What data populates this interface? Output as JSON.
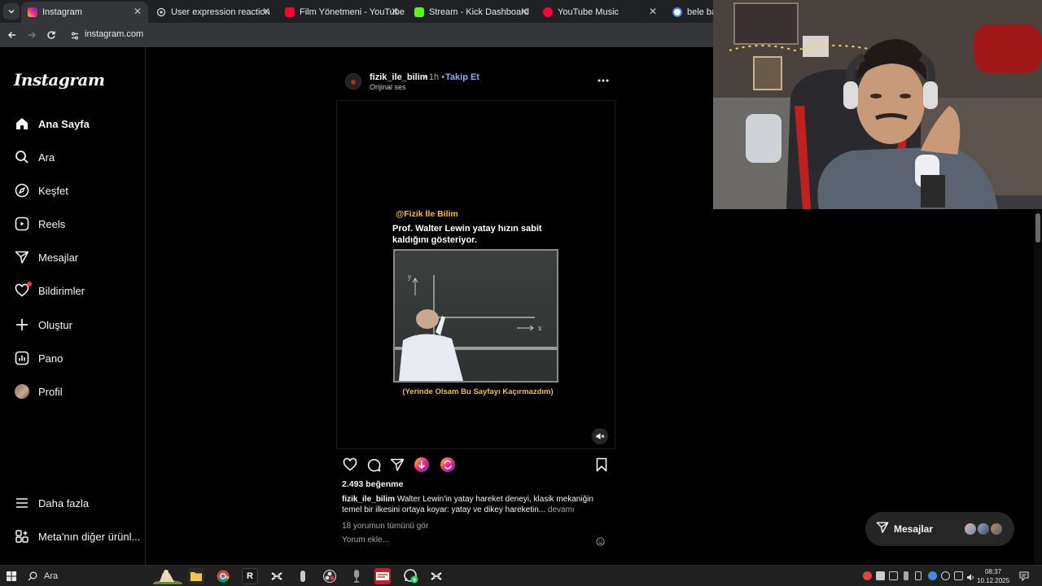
{
  "browser": {
    "tabs": [
      {
        "label": "Instagram",
        "icon": "instagram-icon",
        "color": "#e1306c",
        "active": true
      },
      {
        "label": "User expression reaction",
        "icon": "openai-icon",
        "color": "#d9d9d9",
        "active": false
      },
      {
        "label": "Film Yönetmeni - YouTube",
        "icon": "youtube-icon",
        "color": "#ff0033",
        "active": false
      },
      {
        "label": "Stream - Kick Dashboard",
        "icon": "kick-icon",
        "color": "#53fc18",
        "active": false
      },
      {
        "label": "YouTube Music",
        "icon": "youtube-music-icon",
        "color": "#ff0033",
        "active": false
      },
      {
        "label": "bele bağl",
        "icon": "google-icon",
        "color": "#4285f4",
        "active": false
      }
    ],
    "url": "instagram.com"
  },
  "sidebar": {
    "logo": "Instagram",
    "items": [
      {
        "label": "Ana Sayfa",
        "icon": "home-icon"
      },
      {
        "label": "Ara",
        "icon": "search-icon"
      },
      {
        "label": "Keşfet",
        "icon": "compass-icon"
      },
      {
        "label": "Reels",
        "icon": "reels-icon"
      },
      {
        "label": "Mesajlar",
        "icon": "messenger-icon"
      },
      {
        "label": "Bildirimler",
        "icon": "heart-icon"
      },
      {
        "label": "Oluştur",
        "icon": "plus-icon"
      },
      {
        "label": "Pano",
        "icon": "dashboard-icon"
      },
      {
        "label": "Profil",
        "icon": "avatar"
      }
    ],
    "more": "Daha fazla",
    "meta": "Meta'nın diğer ürünl..."
  },
  "post": {
    "username": "fizik_ile_bilim",
    "time": "• 1h •",
    "follow": "Takip Et",
    "audio": "Orijinal ses",
    "video": {
      "handle": "@Fizik İle Bilim",
      "title": "Prof. Walter Lewin yatay hızın sabit kaldığını gösteriyor.",
      "caption": "(Yerinde Olsam Bu Sayfayı Kaçırmazdım)"
    },
    "likes": "2.493 beğenme",
    "caption_user": "fizik_ile_bilim",
    "caption_text": "Walter Lewin'in yatay hareket deneyi, klasik mekaniğin temel bir ilkesini ortaya koyar: yatay ve dikey hareketin...",
    "caption_more": "devamı",
    "comments_link": "18 yorumun tümünü gör",
    "comment_placeholder": "Yorum ekle..."
  },
  "messages_pill": {
    "label": "Mesajlar"
  },
  "taskbar": {
    "search": "Ara",
    "time": "08:37",
    "date": "10.12.2025"
  }
}
